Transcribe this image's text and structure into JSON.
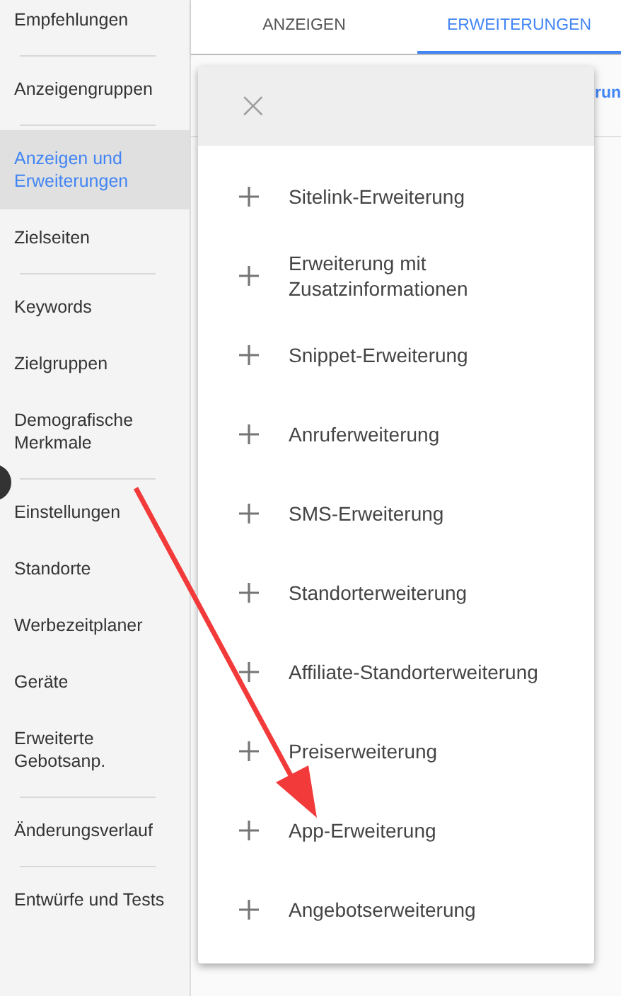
{
  "sidebar": {
    "groups": [
      {
        "items": [
          {
            "label": "Empfehlungen",
            "selected": false
          }
        ]
      },
      {
        "items": [
          {
            "label": "Anzeigengruppen",
            "selected": false
          }
        ]
      },
      {
        "items": [
          {
            "label": "Anzeigen und Erweiterungen",
            "selected": true
          },
          {
            "label": "Zielseiten",
            "selected": false
          }
        ]
      },
      {
        "items": [
          {
            "label": "Keywords",
            "selected": false
          },
          {
            "label": "Zielgruppen",
            "selected": false
          },
          {
            "label": "Demografische Merkmale",
            "selected": false
          }
        ]
      },
      {
        "items": [
          {
            "label": "Einstellungen",
            "selected": false
          },
          {
            "label": "Standorte",
            "selected": false
          },
          {
            "label": "Werbezeitplaner",
            "selected": false
          },
          {
            "label": "Geräte",
            "selected": false
          },
          {
            "label": "Erweiterte Gebotsanp.",
            "selected": false
          }
        ]
      },
      {
        "items": [
          {
            "label": "Änderungsverlauf",
            "selected": false
          }
        ]
      },
      {
        "items": [
          {
            "label": "Entwürfe und Tests",
            "selected": false
          }
        ]
      }
    ]
  },
  "tabs": [
    {
      "label": "ANZEIGEN",
      "selected": false
    },
    {
      "label": "ERWEITERUNGEN",
      "selected": true
    }
  ],
  "background_text": "run",
  "menu": {
    "close": "×",
    "items": [
      {
        "label": "Sitelink-Erweiterung"
      },
      {
        "label": "Erweiterung mit Zusatzinformationen"
      },
      {
        "label": "Snippet-Erweiterung"
      },
      {
        "label": "Anruferweiterung"
      },
      {
        "label": "SMS-Erweiterung"
      },
      {
        "label": "Standorterweiterung"
      },
      {
        "label": "Affiliate-Standorterweiterung"
      },
      {
        "label": "Preiserweiterung"
      },
      {
        "label": "App-Erweiterung"
      },
      {
        "label": "Angebotserweiterung"
      }
    ]
  }
}
